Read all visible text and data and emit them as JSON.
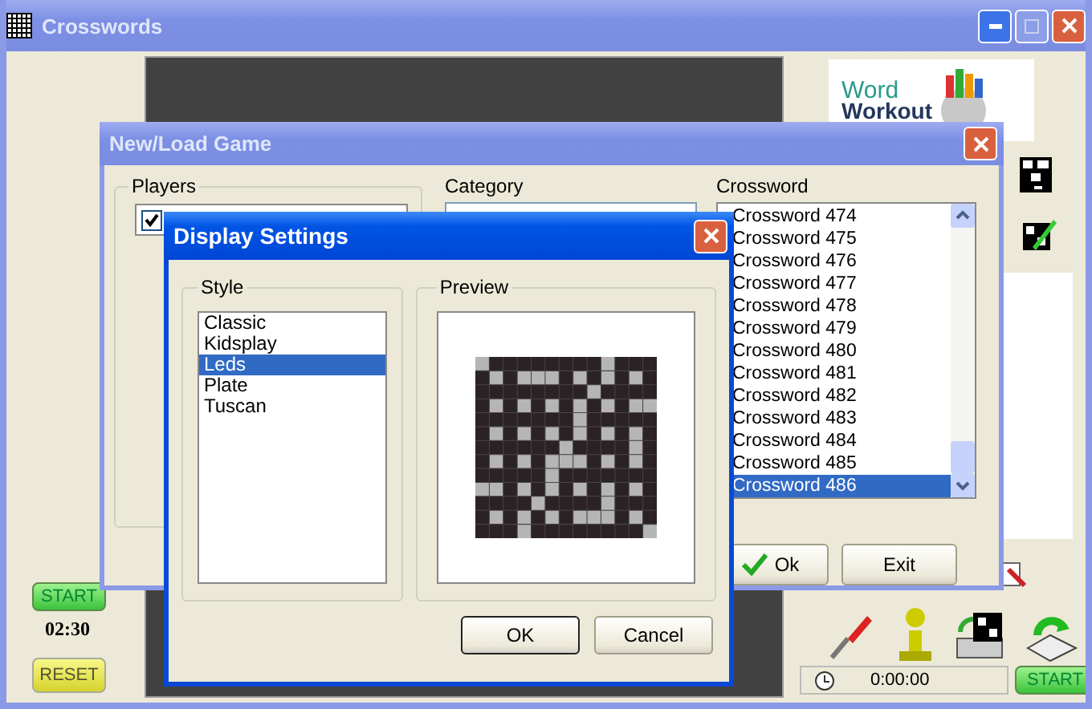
{
  "window": {
    "title": "Crosswords"
  },
  "timer_panel": {
    "start_label": "START",
    "time": "02:30",
    "reset_label": "RESET"
  },
  "logo": {
    "line1": "Word",
    "line2": "Workout"
  },
  "status": {
    "elapsed": "0:00:00",
    "start_label": "START"
  },
  "new_load_dialog": {
    "title": "New/Load Game",
    "players_label": "Players",
    "players": [
      {
        "checked": true
      }
    ],
    "category_label": "Category",
    "crossword_label": "Crossword",
    "crosswords": [
      {
        "label": "Crossword 474",
        "selected": false
      },
      {
        "label": "Crossword 475",
        "selected": false
      },
      {
        "label": "Crossword 476",
        "selected": false
      },
      {
        "label": "Crossword 477",
        "selected": false
      },
      {
        "label": "Crossword 478",
        "selected": false
      },
      {
        "label": "Crossword 479",
        "selected": false
      },
      {
        "label": "Crossword 480",
        "selected": false
      },
      {
        "label": "Crossword 481",
        "selected": false
      },
      {
        "label": "Crossword 482",
        "selected": false
      },
      {
        "label": "Crossword 483",
        "selected": false
      },
      {
        "label": "Crossword 484",
        "selected": false
      },
      {
        "label": "Crossword 485",
        "selected": false
      },
      {
        "label": "Crossword 486",
        "selected": true
      }
    ],
    "buttons": [
      {
        "label": "Ok",
        "kind": "confirm"
      },
      {
        "label": "Exit",
        "kind": "plain"
      }
    ]
  },
  "display_dialog": {
    "title": "Display Settings",
    "style_label": "Style",
    "styles": [
      {
        "label": "Classic",
        "selected": false
      },
      {
        "label": "Kidsplay",
        "selected": false
      },
      {
        "label": "Leds",
        "selected": true
      },
      {
        "label": "Plate",
        "selected": false
      },
      {
        "label": "Tuscan",
        "selected": false
      }
    ],
    "preview_label": "Preview",
    "buttons": [
      {
        "label": "OK",
        "default": true
      },
      {
        "label": "Cancel",
        "default": false
      }
    ]
  }
}
